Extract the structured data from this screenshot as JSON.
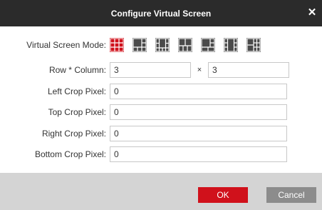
{
  "dialog": {
    "title": "Configure Virtual Screen",
    "close_icon": "close-icon"
  },
  "form": {
    "mode_label": "Virtual Screen Mode:",
    "mode_options": [
      "3x3 grid",
      "1+5 layout",
      "1+7 layout",
      "4+? layout",
      "1+6 layout",
      "center layout",
      "2+? layout"
    ],
    "selected_mode_index": 0,
    "row_column_label": "Row * Column:",
    "rows_value": "3",
    "times_symbol": "×",
    "columns_value": "3",
    "left_crop_label": "Left Crop Pixel:",
    "left_crop_value": "0",
    "top_crop_label": "Top Crop Pixel:",
    "top_crop_value": "0",
    "right_crop_label": "Right Crop Pixel:",
    "right_crop_value": "0",
    "bottom_crop_label": "Bottom Crop Pixel:",
    "bottom_crop_value": "0"
  },
  "footer": {
    "ok_label": "OK",
    "cancel_label": "Cancel"
  },
  "colors": {
    "titlebar": "#2b2b2b",
    "accent_red": "#d0111b",
    "icon_dark": "#4a4a4a",
    "footer": "#d4d4d4",
    "cancel": "#8c8c8c"
  }
}
